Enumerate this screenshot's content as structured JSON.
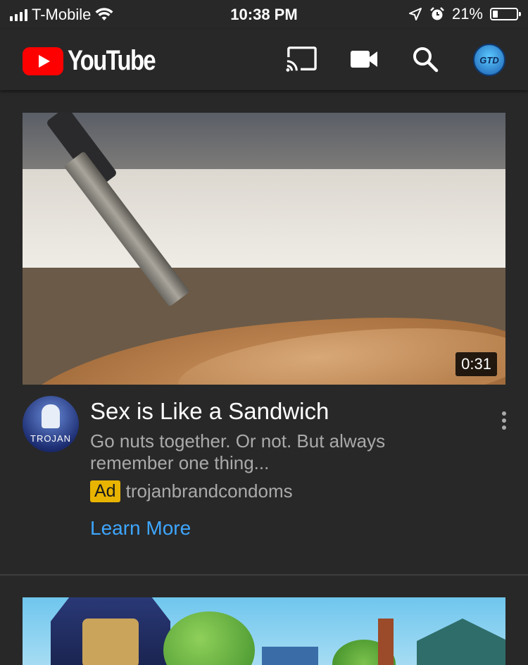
{
  "status_bar": {
    "carrier": "T-Mobile",
    "time": "10:38 PM",
    "battery_percent": "21%",
    "battery_level": 0.21,
    "icons": [
      "signal-icon",
      "wifi-icon",
      "location-icon",
      "alarm-icon",
      "battery-icon"
    ]
  },
  "app_bar": {
    "logo_text": "YouTube",
    "avatar_text": "GTD",
    "icons": [
      "cast-icon",
      "camera-icon",
      "search-icon",
      "account-avatar"
    ],
    "brand_color": "#ff0000"
  },
  "ad_card": {
    "duration": "0:31",
    "channel_avatar_text": "TROJAN",
    "title": "Sex is Like a Sandwich",
    "description": "Go nuts together. Or not. But always remember one thing...",
    "ad_badge": "Ad",
    "advertiser": "trojanbrandcondoms",
    "cta": "Learn More",
    "cta_color": "#3ea6ff",
    "badge_color": "#e8b400"
  }
}
